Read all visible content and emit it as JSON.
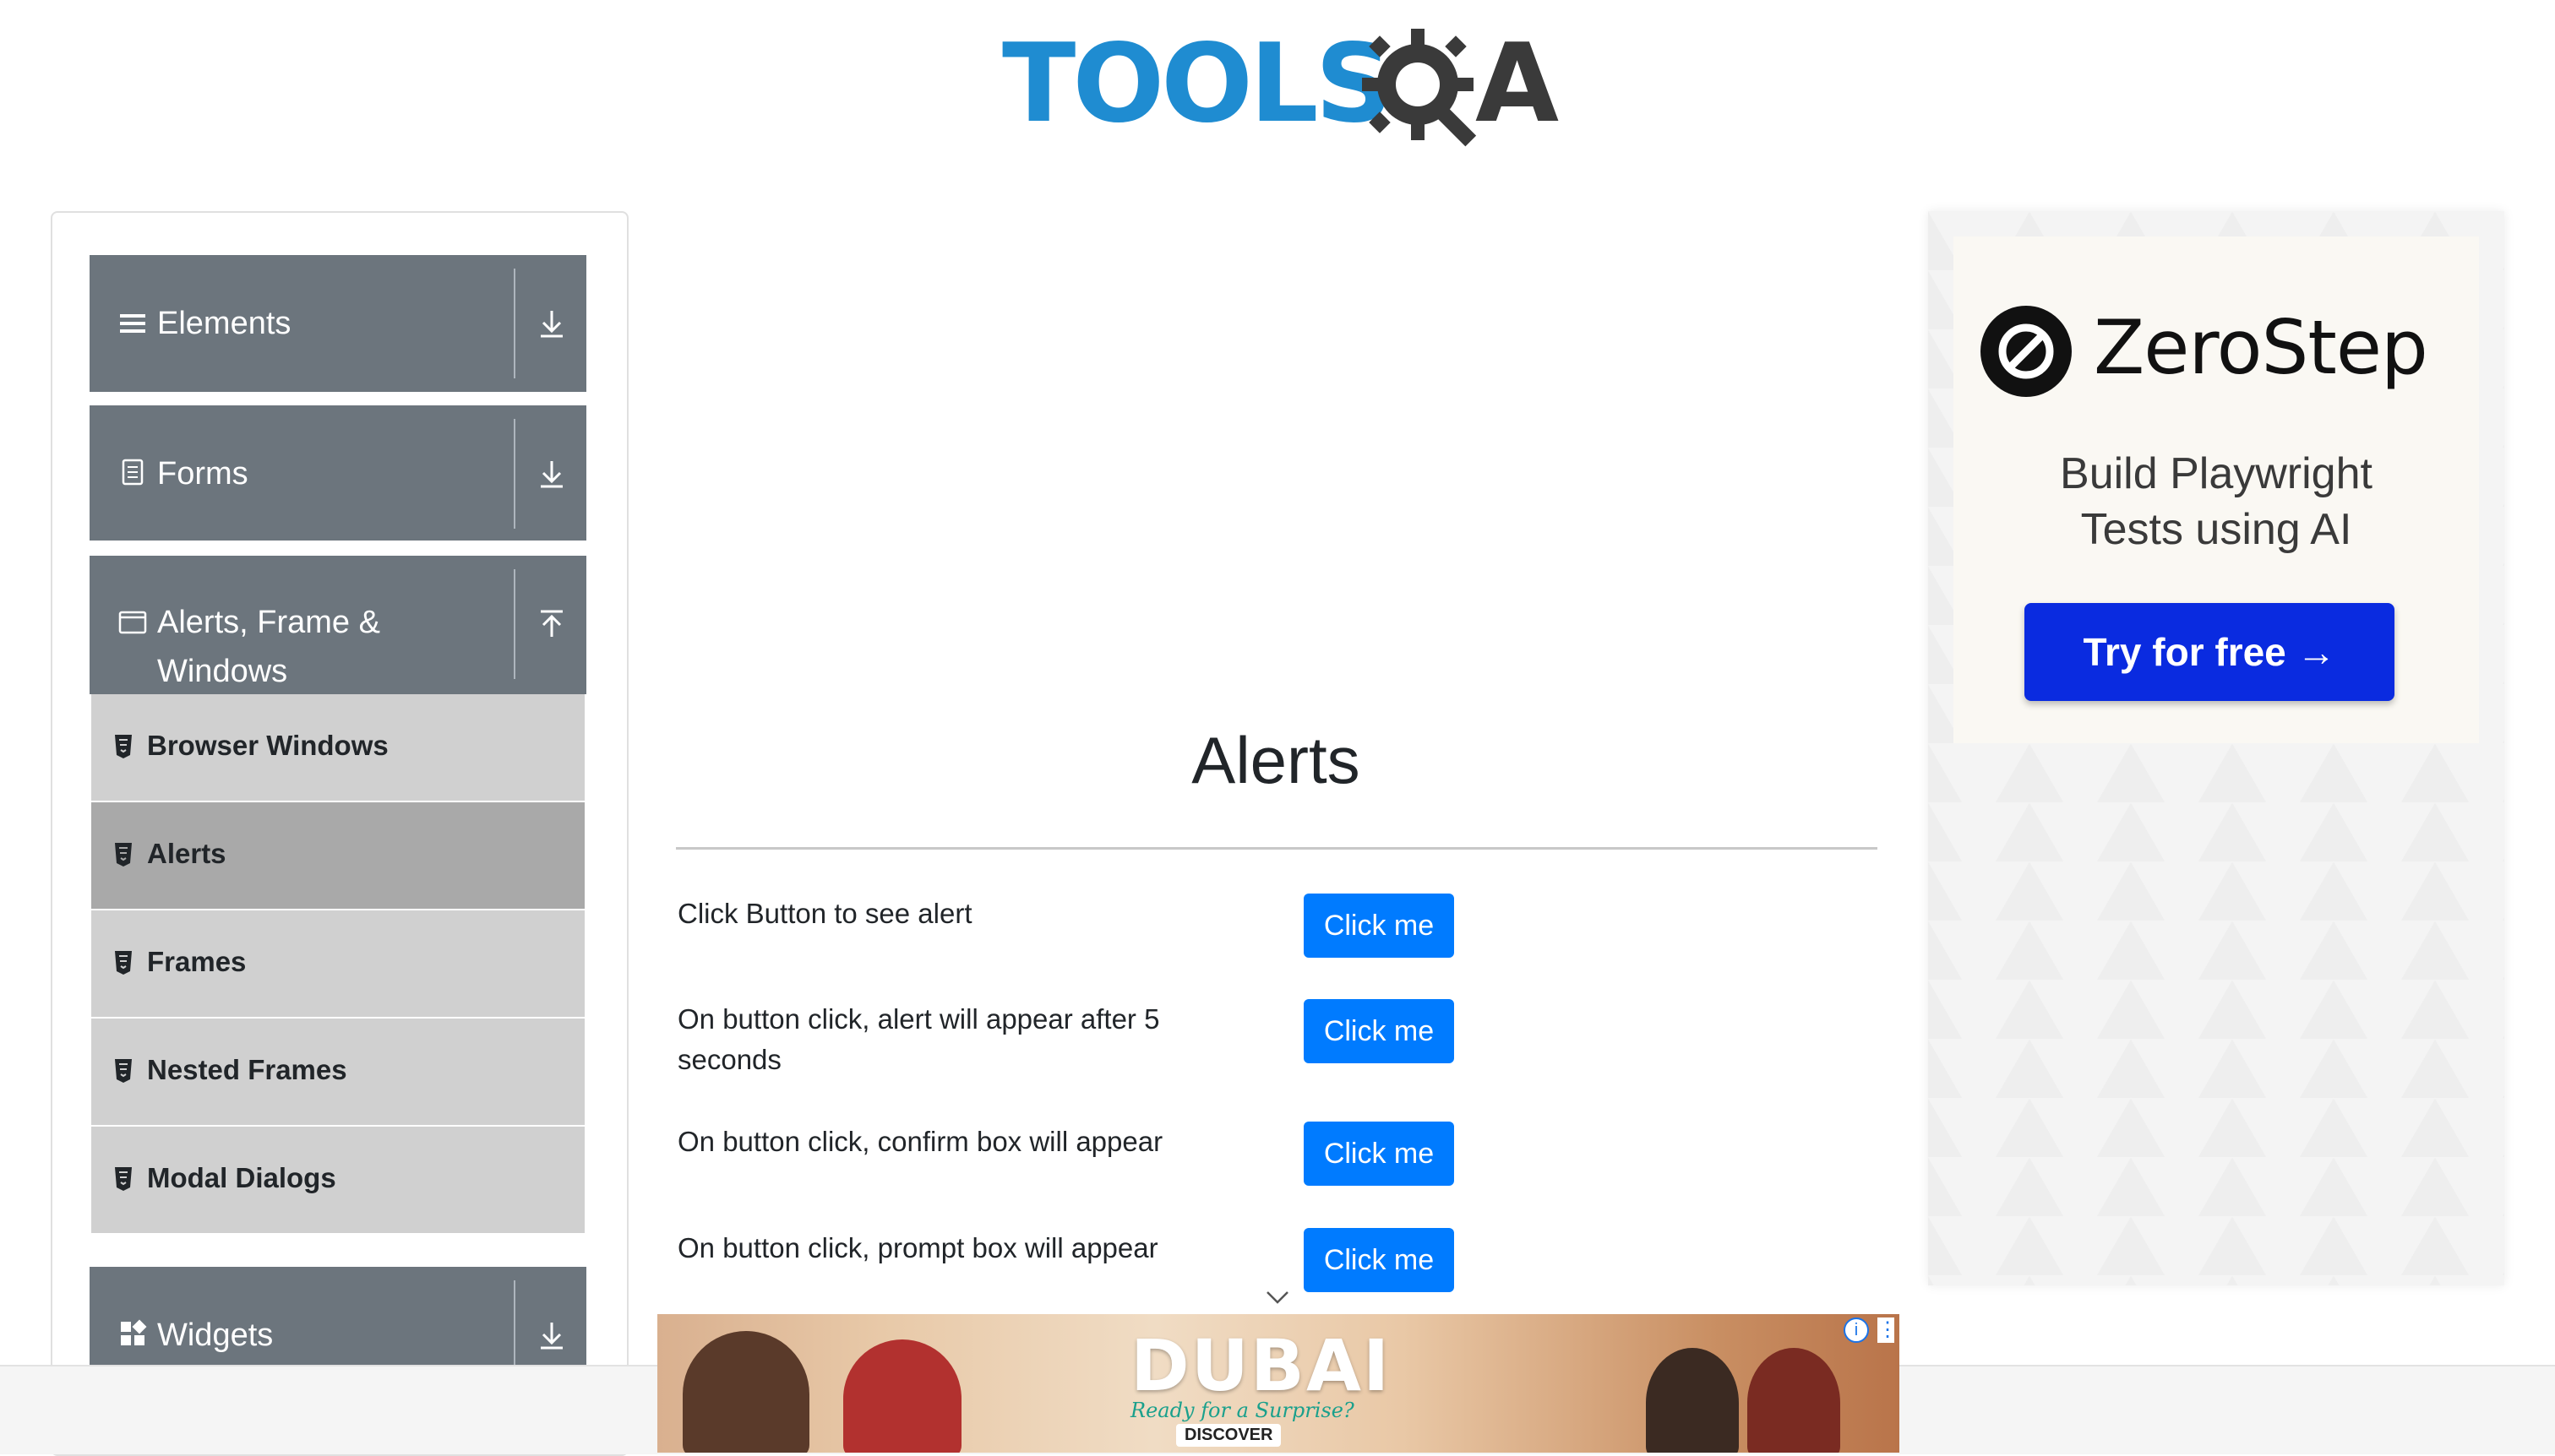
{
  "header": {
    "logo_tools": "TOOLS",
    "logo_qa": "A"
  },
  "sidebar": {
    "groups": [
      {
        "label": "Elements",
        "icon": "hamburger-icon",
        "arrow": "download-arrow-icon",
        "expanded": false
      },
      {
        "label": "Forms",
        "icon": "form-document-icon",
        "arrow": "download-arrow-icon",
        "expanded": false
      },
      {
        "label": "Alerts, Frame & Windows",
        "icon": "browser-window-icon",
        "arrow": "upload-arrow-icon",
        "expanded": true
      },
      {
        "label": "Widgets",
        "icon": "widgets-grid-icon",
        "arrow": "download-arrow-icon",
        "expanded": false
      }
    ],
    "subitems": [
      {
        "label": "Browser Windows",
        "active": false
      },
      {
        "label": "Alerts",
        "active": true
      },
      {
        "label": "Frames",
        "active": false
      },
      {
        "label": "Nested Frames",
        "active": false
      },
      {
        "label": "Modal Dialogs",
        "active": false
      }
    ]
  },
  "main": {
    "title": "Alerts",
    "rows": [
      {
        "text": "Click Button to see alert",
        "button": "Click me"
      },
      {
        "text": "On button click, alert will appear after 5 seconds",
        "button": "Click me"
      },
      {
        "text": "On button click, confirm box will appear",
        "button": "Click me"
      },
      {
        "text": "On button click, prompt box will appear",
        "button": "Click me"
      }
    ]
  },
  "right_ad": {
    "brand": "ZeroStep",
    "tagline_line1": "Build Playwright",
    "tagline_line2": "Tests using AI",
    "cta": "Try for free →"
  },
  "bottom_ad": {
    "headline": "DUBAI",
    "script": "Ready for a Surprise?",
    "cta": "DISCOVER"
  },
  "colors": {
    "brand_blue": "#1f8cd1",
    "sidebar_group": "#6c757d",
    "sidebar_item": "#d0d0d0",
    "sidebar_item_active": "#a9a9a9",
    "button_primary": "#007bff",
    "ad_cta": "#0a2be0"
  }
}
